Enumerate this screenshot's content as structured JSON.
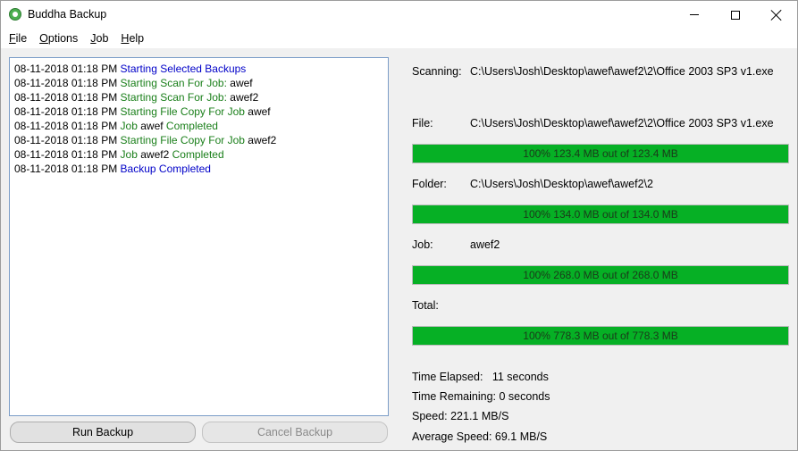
{
  "window": {
    "title": "Buddha Backup"
  },
  "menu": {
    "items": [
      {
        "label": "File",
        "mnemonic": "F",
        "rest": "ile"
      },
      {
        "label": "Options",
        "mnemonic": "O",
        "rest": "ptions"
      },
      {
        "label": "Job",
        "mnemonic": "J",
        "rest": "ob"
      },
      {
        "label": "Help",
        "mnemonic": "H",
        "rest": "elp"
      }
    ]
  },
  "log": {
    "lines": [
      {
        "time": "08-11-2018 01:18 PM",
        "msg": "Starting Selected Backups",
        "msg_color": "blue",
        "suffix": "",
        "suffix2": ""
      },
      {
        "time": "08-11-2018 01:18 PM",
        "msg": "Starting Scan For Job:",
        "msg_color": "green",
        "suffix": " awef",
        "suffix2": ""
      },
      {
        "time": "08-11-2018 01:18 PM",
        "msg": "Starting Scan For Job:",
        "msg_color": "green",
        "suffix": " awef2",
        "suffix2": ""
      },
      {
        "time": "08-11-2018 01:18 PM",
        "msg": "Starting File Copy For Job",
        "msg_color": "green",
        "suffix": " awef",
        "suffix2": ""
      },
      {
        "time": "08-11-2018 01:18 PM",
        "msg": "Job",
        "msg_color": "green",
        "suffix": " awef",
        "suffix2": " Completed"
      },
      {
        "time": "08-11-2018 01:18 PM",
        "msg": "Starting File Copy For Job",
        "msg_color": "green",
        "suffix": " awef2",
        "suffix2": ""
      },
      {
        "time": "08-11-2018 01:18 PM",
        "msg": "Job",
        "msg_color": "green",
        "suffix": " awef2",
        "suffix2": " Completed"
      },
      {
        "time": "08-11-2018 01:18 PM",
        "msg": "Backup Completed",
        "msg_color": "blue",
        "suffix": "",
        "suffix2": ""
      }
    ]
  },
  "buttons": {
    "run_label": "Run Backup",
    "cancel_label": "Cancel Backup"
  },
  "status": {
    "scanning_label": "Scanning:",
    "scanning_value": "C:\\Users\\Josh\\Desktop\\awef\\awef2\\2\\Office 2003 SP3 v1.exe",
    "file_label": "File:",
    "file_value": "C:\\Users\\Josh\\Desktop\\awef\\awef2\\2\\Office 2003 SP3 v1.exe",
    "file_progress": {
      "percent": 100,
      "text": "100% 123.4 MB out of 123.4 MB"
    },
    "folder_label": "Folder:",
    "folder_value": "C:\\Users\\Josh\\Desktop\\awef\\awef2\\2",
    "folder_progress": {
      "percent": 100,
      "text": "100% 134.0 MB out of 134.0 MB"
    },
    "job_label": "Job:",
    "job_value": "awef2",
    "job_progress": {
      "percent": 100,
      "text": "100% 268.0 MB out of 268.0 MB"
    },
    "total_label": "Total:",
    "total_progress": {
      "percent": 100,
      "text": "100% 778.3 MB out of 778.3 MB"
    },
    "time_elapsed": "Time Elapsed:   11 seconds",
    "time_remaining": "Time Remaining: 0 seconds",
    "speed": "Speed: 221.1 MB/S",
    "average_speed": "Average Speed: 69.1 MB/S"
  },
  "colors": {
    "progress_fill": "#06b025",
    "log_blue": "#0000c8",
    "log_green": "#1a7f1a"
  }
}
